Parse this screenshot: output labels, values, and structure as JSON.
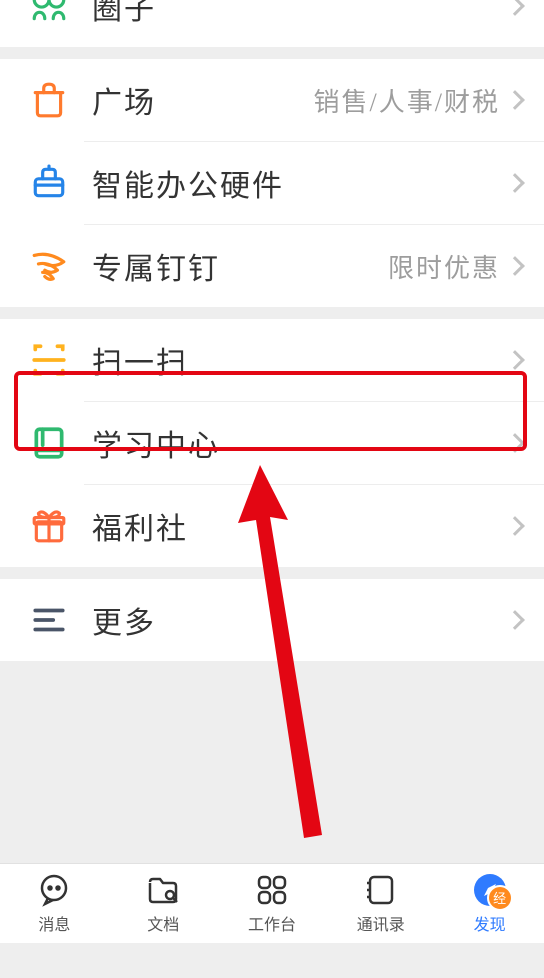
{
  "rows": {
    "circle": {
      "label": "圈子"
    },
    "plaza": {
      "label": "广场",
      "extra": "销售/人事/财税"
    },
    "hardware": {
      "label": "智能办公硬件"
    },
    "exclusive": {
      "label": "专属钉钉",
      "extra": "限时优惠"
    },
    "scan": {
      "label": "扫一扫"
    },
    "learn": {
      "label": "学习中心"
    },
    "welfare": {
      "label": "福利社"
    },
    "more": {
      "label": "更多"
    }
  },
  "tabs": {
    "messages": "消息",
    "docs": "文档",
    "workbench": "工作台",
    "contacts": "通讯录",
    "discover": "发现"
  }
}
